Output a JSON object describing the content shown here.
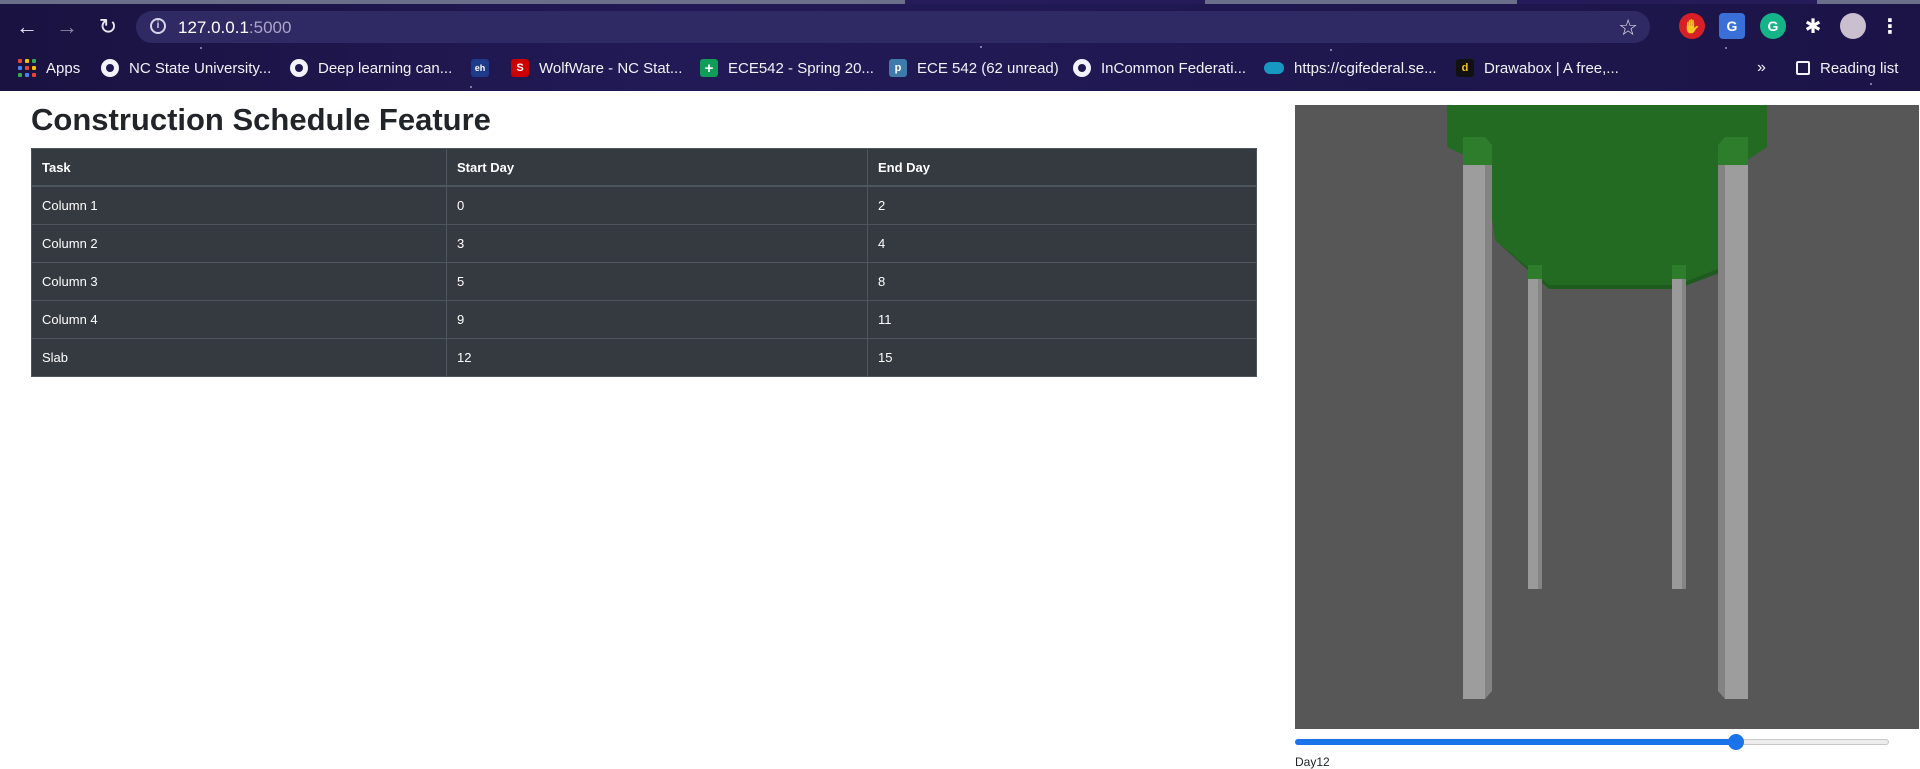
{
  "browser": {
    "url_host": "127.0.0.1",
    "url_port": ":5000",
    "bookmarks": [
      {
        "label": "Apps",
        "icon": "apps-grid-icon"
      },
      {
        "label": "NC State University...",
        "icon": "globe-icon"
      },
      {
        "label": "Deep learning can...",
        "icon": "globe-icon"
      },
      {
        "label": "",
        "icon": "eh-site-icon",
        "icon_text": "eh"
      },
      {
        "label": "WolfWare - NC Stat...",
        "icon": "ncstate-s-icon",
        "icon_text": "S"
      },
      {
        "label": "ECE542 - Spring 20...",
        "icon": "sheets-icon",
        "icon_text": "+"
      },
      {
        "label": "ECE 542 (62 unread)",
        "icon": "piazza-icon",
        "icon_text": "p"
      },
      {
        "label": "InCommon Federati...",
        "icon": "globe-icon"
      },
      {
        "label": "https://cgifederal.se...",
        "icon": "cloud-icon"
      },
      {
        "label": "Drawabox | A free,...",
        "icon": "drawabox-icon",
        "icon_text": "d"
      }
    ],
    "overflow_label": "»",
    "reading_list_label": "Reading list",
    "accent_colors": {
      "chrome_bg": "#1f1850",
      "omnibox_bg": "#2f2a63"
    }
  },
  "page": {
    "title": "Construction Schedule Feature",
    "table": {
      "headers": [
        "Task",
        "Start Day",
        "End Day"
      ],
      "rows": [
        [
          "Column 1",
          "0",
          "2"
        ],
        [
          "Column 2",
          "3",
          "4"
        ],
        [
          "Column 3",
          "5",
          "8"
        ],
        [
          "Column 4",
          "9",
          "11"
        ],
        [
          "Slab",
          "12",
          "15"
        ]
      ]
    },
    "viewer": {
      "background_color": "#575757",
      "slab_color": "#236b22",
      "column_color": "#9a9a9a"
    },
    "slider": {
      "value": 12,
      "min": 0,
      "max": 15,
      "fraction": 0.742
    },
    "day_label": "Day12"
  }
}
